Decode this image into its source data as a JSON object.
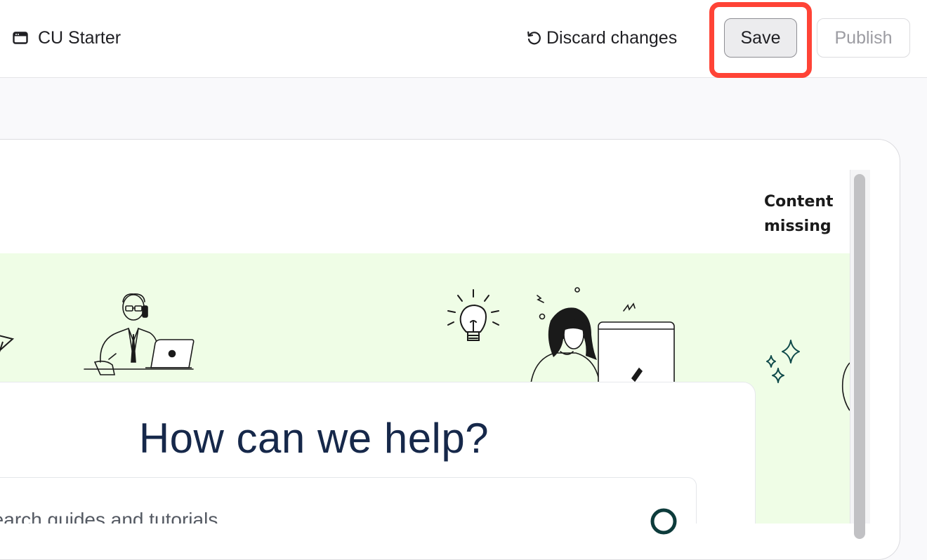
{
  "topbar": {
    "site_name": "CU Starter",
    "site_icon": "browser-window-icon",
    "discard_label": "Discard changes",
    "discard_icon": "undo-icon",
    "save_label": "Save",
    "publish_label": "Publish",
    "highlight_color": "#ff4336"
  },
  "preview": {
    "content_missing": "Content missing",
    "hero_bg": "#effde6",
    "help_title": "How can we help?",
    "search_placeholder": "Search guides and tutorials",
    "search_icon": "search-icon"
  }
}
